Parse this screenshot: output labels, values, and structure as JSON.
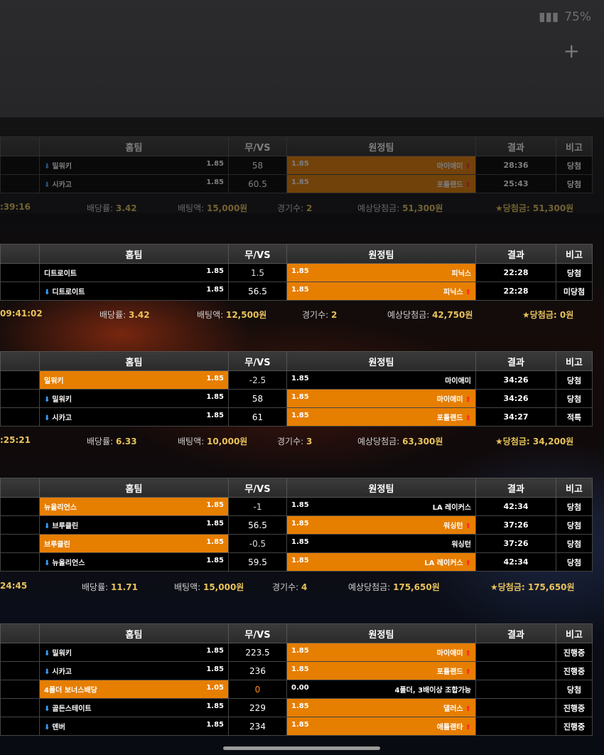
{
  "status_bar": {
    "battery": "75%"
  },
  "headers": {
    "home": "홈팀",
    "vs": "무/VS",
    "away": "원정팀",
    "result": "결과",
    "note": "비고"
  },
  "summary_labels": {
    "rate": "배당률:",
    "stake": "배팅액:",
    "count": "경기수:",
    "expected": "예상당첨금:",
    "won": "★당첨금:"
  },
  "slips": [
    {
      "rows": [
        {
          "home": "밀워키",
          "home_arrow": true,
          "home_odds": "1.85",
          "vs": "58",
          "vs_blue": true,
          "away_odds": "1.85",
          "away": "마이애미",
          "away_arrow": true,
          "sel": "away",
          "score": "28:36",
          "note": "당첨",
          "note_type": "win"
        },
        {
          "home": "시카고",
          "home_arrow": true,
          "home_odds": "1.85",
          "vs": "60.5",
          "vs_blue": true,
          "away_odds": "1.85",
          "away": "포틀랜드",
          "away_arrow": true,
          "sel": "away",
          "score": "25:43",
          "note": "당첨",
          "note_type": "win"
        }
      ],
      "summary": {
        "time": ":39:16",
        "rate": "3.42",
        "stake": "15,000원",
        "count": "2",
        "expected": "51,300원",
        "won": "51,300원"
      }
    },
    {
      "rows": [
        {
          "home": "디트로이트",
          "home_arrow": false,
          "home_odds": "1.85",
          "vs": "1.5",
          "vs_blue": false,
          "away_odds": "1.85",
          "away": "피닉스",
          "away_arrow": false,
          "sel": "away",
          "score": "22:28",
          "note": "당첨",
          "note_type": "win"
        },
        {
          "home": "디트로이트",
          "home_arrow": true,
          "home_odds": "1.85",
          "vs": "56.5",
          "vs_blue": true,
          "away_odds": "1.85",
          "away": "피닉스",
          "away_arrow": true,
          "sel": "away",
          "score": "22:28",
          "note": "미당첨",
          "note_type": "lose"
        }
      ],
      "summary": {
        "time": "09:41:02",
        "rate": "3.42",
        "stake": "12,500원",
        "count": "2",
        "expected": "42,750원",
        "won": "0원"
      }
    },
    {
      "rows": [
        {
          "home": "밀워키",
          "home_arrow": false,
          "home_odds": "1.85",
          "vs": "-2.5",
          "vs_blue": false,
          "away_odds": "1.85",
          "away": "마이애미",
          "away_arrow": false,
          "sel": "home",
          "score": "34:26",
          "note": "당첨",
          "note_type": "win"
        },
        {
          "home": "밀워키",
          "home_arrow": true,
          "home_odds": "1.85",
          "vs": "58",
          "vs_blue": true,
          "away_odds": "1.85",
          "away": "마이애미",
          "away_arrow": true,
          "sel": "away",
          "score": "34:26",
          "note": "당첨",
          "note_type": "win"
        },
        {
          "home": "시카고",
          "home_arrow": true,
          "home_odds": "1.85",
          "vs": "61",
          "vs_blue": true,
          "away_odds": "1.85",
          "away": "포틀랜드",
          "away_arrow": true,
          "sel": "away",
          "score": "34:27",
          "note": "적특",
          "note_type": "push"
        }
      ],
      "summary": {
        "time": ":25:21",
        "rate": "6.33",
        "stake": "10,000원",
        "count": "3",
        "expected": "63,300원",
        "won": "34,200원"
      }
    },
    {
      "rows": [
        {
          "home": "뉴올리언스",
          "home_arrow": false,
          "home_odds": "1.85",
          "vs": "-1",
          "vs_blue": false,
          "away_odds": "1.85",
          "away": "LA 레이커스",
          "away_arrow": false,
          "sel": "home",
          "score": "42:34",
          "note": "당첨",
          "note_type": "win"
        },
        {
          "home": "브루클린",
          "home_arrow": true,
          "home_odds": "1.85",
          "vs": "56.5",
          "vs_blue": true,
          "away_odds": "1.85",
          "away": "워싱턴",
          "away_arrow": true,
          "sel": "away",
          "score": "37:26",
          "note": "당첨",
          "note_type": "win"
        },
        {
          "home": "브루클린",
          "home_arrow": false,
          "home_odds": "1.85",
          "vs": "-0.5",
          "vs_blue": false,
          "away_odds": "1.85",
          "away": "워싱턴",
          "away_arrow": false,
          "sel": "home",
          "score": "37:26",
          "note": "당첨",
          "note_type": "win"
        },
        {
          "home": "뉴올리언스",
          "home_arrow": true,
          "home_odds": "1.85",
          "vs": "59.5",
          "vs_blue": true,
          "away_odds": "1.85",
          "away": "LA 레이커스",
          "away_arrow": true,
          "sel": "away",
          "score": "42:34",
          "note": "당첨",
          "note_type": "win"
        }
      ],
      "summary": {
        "time": "24:45",
        "rate": "11.71",
        "stake": "15,000원",
        "count": "4",
        "expected": "175,650원",
        "won": "175,650원"
      }
    },
    {
      "rows": [
        {
          "home": "밀워키",
          "home_arrow": true,
          "home_odds": "1.85",
          "vs": "223.5",
          "vs_blue": true,
          "away_odds": "1.85",
          "away": "마이애미",
          "away_arrow": true,
          "sel": "away",
          "score": "",
          "note": "진행중",
          "note_type": "live"
        },
        {
          "home": "시카고",
          "home_arrow": true,
          "home_odds": "1.85",
          "vs": "236",
          "vs_blue": true,
          "away_odds": "1.85",
          "away": "포틀랜드",
          "away_arrow": true,
          "sel": "away",
          "score": "",
          "note": "진행중",
          "note_type": "live"
        },
        {
          "home": "4폴더 보너스배당",
          "home_arrow": false,
          "home_odds": "1.05",
          "vs": "0",
          "vs_blue": false,
          "away_odds": "0.00",
          "away": "4폴더, 3배이상 조합가능",
          "away_arrow": false,
          "sel": "home",
          "score": "",
          "note": "당첨",
          "note_type": "win",
          "vs_orange": true
        },
        {
          "home": "골든스테이트",
          "home_arrow": true,
          "home_odds": "1.85",
          "vs": "229",
          "vs_blue": true,
          "away_odds": "1.85",
          "away": "댈러스",
          "away_arrow": true,
          "sel": "away",
          "score": "",
          "note": "진행중",
          "note_type": "live"
        },
        {
          "home": "덴버",
          "home_arrow": true,
          "home_odds": "1.85",
          "vs": "234",
          "vs_blue": true,
          "away_odds": "1.85",
          "away": "애틀랜타",
          "away_arrow": true,
          "sel": "away",
          "score": "",
          "note": "진행중",
          "note_type": "live"
        }
      ],
      "summary": null
    }
  ]
}
